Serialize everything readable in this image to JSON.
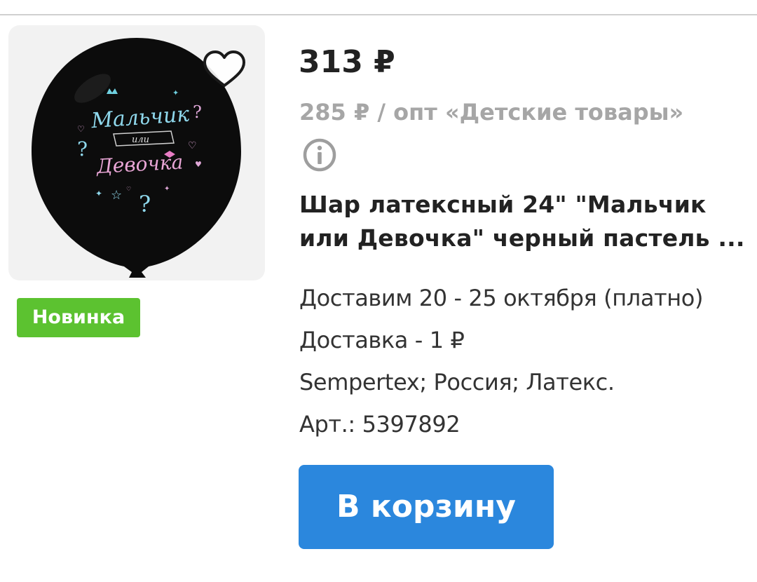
{
  "product": {
    "image_alt": "Шар латексный Мальчик или Девочка",
    "image_text_line1": "Мальчик",
    "image_text_line2": "или",
    "image_text_line3": "Девочка",
    "badge": "Новинка",
    "price": "313 ₽",
    "wholesale_price": "285 ₽ / опт «Детские товары»",
    "title_line1": "Шар латексный 24\" \"Мальчик",
    "title_line2": "или Девочка\" черный пастель ...",
    "delivery_date": "Доставим 20 - 25 октября (платно)",
    "delivery_cost": "Доставка - 1 ₽",
    "attributes": "Sempertex; Россия; Латекс.",
    "article": "Арт.: 5397892"
  },
  "actions": {
    "add_to_cart": "В корзину"
  },
  "colors": {
    "badge_bg": "#5cc230",
    "button_bg": "#2b87dd",
    "muted_text": "#a6a6a6",
    "divider": "#d0d0d0"
  },
  "icons": {
    "favorite": "heart-icon",
    "info": "info-icon"
  }
}
